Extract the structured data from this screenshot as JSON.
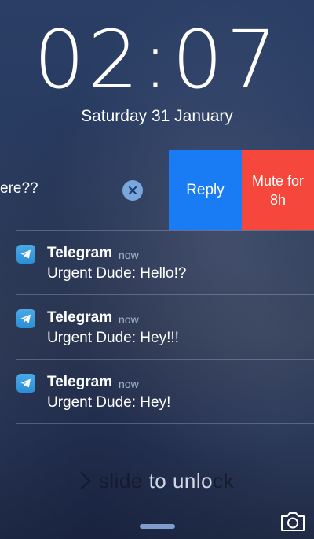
{
  "lock": {
    "time": "02:07",
    "date": "Saturday 31 January"
  },
  "swiped_notification": {
    "text_fragment": "ere??",
    "actions": {
      "reply": "Reply",
      "mute": "Mute for 8h"
    }
  },
  "notifications": [
    {
      "app": "Telegram",
      "time": "now",
      "message": "Urgent Dude: Hello!?"
    },
    {
      "app": "Telegram",
      "time": "now",
      "message": "Urgent Dude: Hey!!!"
    },
    {
      "app": "Telegram",
      "time": "now",
      "message": "Urgent Dude: Hey!"
    }
  ],
  "slide_to_unlock": {
    "part1": "slide",
    "part2": " to unlo",
    "part3": "ck"
  },
  "icons": {
    "app": "telegram-icon",
    "clear": "clear-icon",
    "chevron": "chevron-right-icon",
    "camera": "camera-icon"
  },
  "colors": {
    "reply": "#1a7cf5",
    "mute": "#f5473b"
  }
}
